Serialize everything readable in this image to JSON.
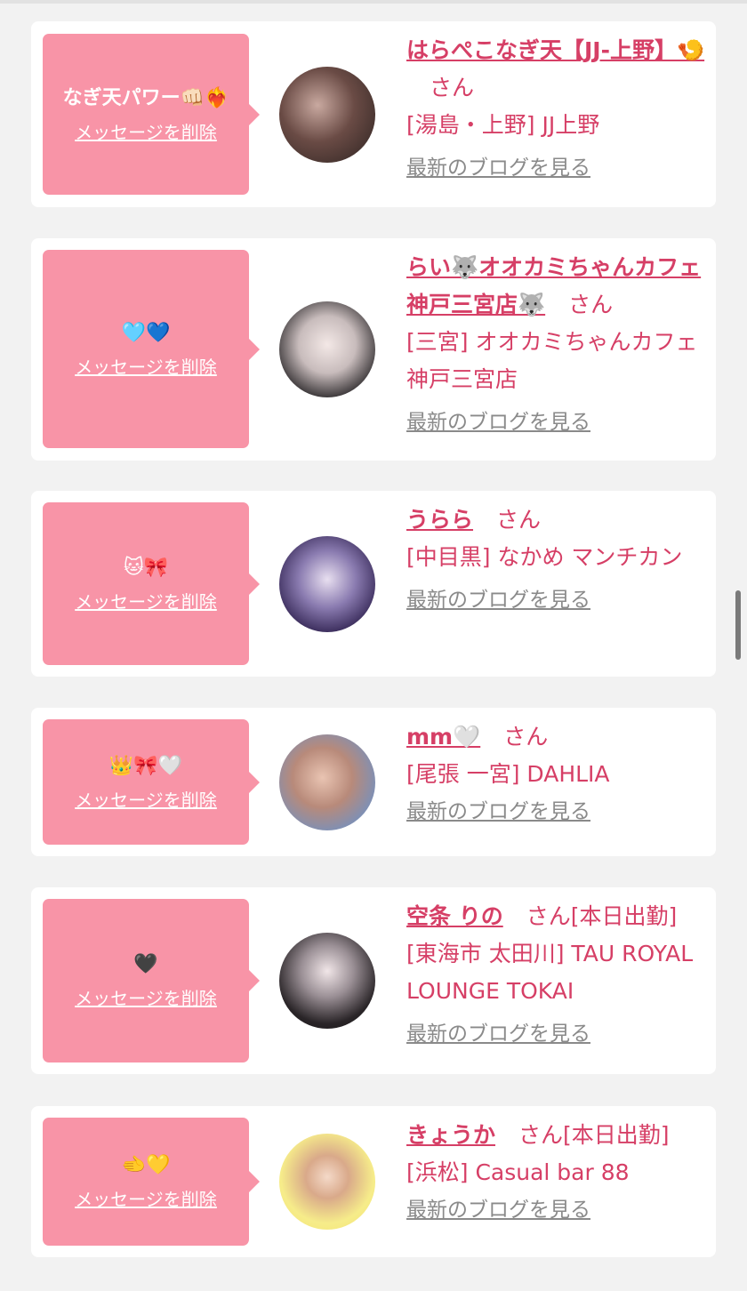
{
  "cards": [
    {
      "message": "なぎ天パワー👊🏻❤️‍🔥",
      "delete_label": "メッセージを削除",
      "name": "はらぺこなぎ天【JJ-上野】🍤",
      "suffix": "さん",
      "status": "",
      "shop": "[湯島・上野] JJ上野",
      "blog_label": "最新のブログを見る"
    },
    {
      "message": "🩵💙",
      "delete_label": "メッセージを削除",
      "name": "らい🐺オオカミちゃんカフェ神戸三宮店🐺",
      "suffix": "さん",
      "status": "",
      "shop": "[三宮] オオカミちゃんカフェ神戸三宮店",
      "blog_label": "最新のブログを見る"
    },
    {
      "message": "🐱🎀",
      "delete_label": "メッセージを削除",
      "name": "うらら",
      "suffix": "さん",
      "status": "",
      "shop": "[中目黒] なかめ マンチカン",
      "blog_label": "最新のブログを見る"
    },
    {
      "message": "👑🎀🤍",
      "delete_label": "メッセージを削除",
      "name": "mm🤍",
      "suffix": "さん",
      "status": "",
      "shop": "[尾張 一宮] DAHLIA",
      "blog_label": "最新のブログを見る"
    },
    {
      "message": "🖤",
      "delete_label": "メッセージを削除",
      "name": "空条 りの",
      "suffix": "さん",
      "status": "[本日出勤]",
      "shop": "[東海市 太田川] TAU ROYAL LOUNGE TOKAI",
      "blog_label": "最新のブログを見る"
    },
    {
      "message": "🫲💛",
      "delete_label": "メッセージを削除",
      "name": "きょうか",
      "suffix": "さん",
      "status": "[本日出勤]",
      "shop": "[浜松] Casual bar 88",
      "blog_label": "最新のブログを見る"
    }
  ]
}
